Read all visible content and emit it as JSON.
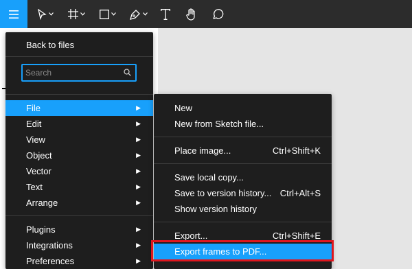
{
  "toolbar": {
    "tools": [
      {
        "name": "menu-icon"
      },
      {
        "name": "move-tool-icon"
      },
      {
        "name": "frame-tool-icon"
      },
      {
        "name": "shape-tool-icon"
      },
      {
        "name": "pen-tool-icon"
      },
      {
        "name": "text-tool-icon"
      },
      {
        "name": "hand-tool-icon"
      },
      {
        "name": "comment-tool-icon"
      }
    ],
    "accent": "#18a0fb"
  },
  "main_menu": {
    "back": "Back to files",
    "search": {
      "placeholder": "Search",
      "value": ""
    },
    "items": [
      {
        "label": "File",
        "active": true
      },
      {
        "label": "Edit"
      },
      {
        "label": "View"
      },
      {
        "label": "Object"
      },
      {
        "label": "Vector"
      },
      {
        "label": "Text"
      },
      {
        "label": "Arrange"
      },
      {
        "label": "Plugins"
      },
      {
        "label": "Integrations"
      },
      {
        "label": "Preferences"
      }
    ]
  },
  "file_submenu": {
    "items": [
      {
        "label": "New",
        "shortcut": ""
      },
      {
        "label": "New from Sketch file...",
        "shortcut": ""
      },
      {
        "label": "Place image...",
        "shortcut": "Ctrl+Shift+K"
      },
      {
        "label": "Save local copy...",
        "shortcut": ""
      },
      {
        "label": "Save to version history...",
        "shortcut": "Ctrl+Alt+S"
      },
      {
        "label": "Show version history",
        "shortcut": ""
      },
      {
        "label": "Export...",
        "shortcut": "Ctrl+Shift+E"
      },
      {
        "label": "Export frames to PDF...",
        "shortcut": "",
        "highlighted": true
      }
    ]
  },
  "colors": {
    "highlight_outline": "#e0161d",
    "menu_bg": "#1e1e1e"
  }
}
